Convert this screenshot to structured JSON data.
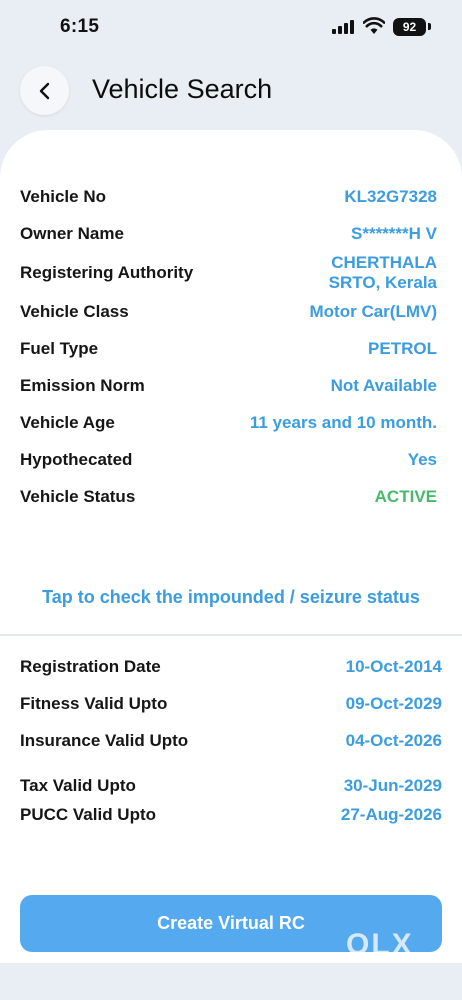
{
  "status_bar": {
    "time": "6:15",
    "battery": "92"
  },
  "header": {
    "title": "Vehicle Search"
  },
  "vehicle": [
    {
      "label": "Vehicle No",
      "value": "KL32G7328"
    },
    {
      "label": "Owner Name",
      "value": "S*******H V"
    },
    {
      "label": "Registering Authority",
      "value_line1": "CHERTHALA",
      "value_line2": "SRTO, Kerala"
    },
    {
      "label": "Vehicle Class",
      "value": "Motor Car(LMV)"
    },
    {
      "label": "Fuel Type",
      "value": "PETROL"
    },
    {
      "label": "Emission Norm",
      "value": "Not Available"
    },
    {
      "label": "Vehicle Age",
      "value": "11 years and 10 month."
    },
    {
      "label": "Hypothecated",
      "value": "Yes"
    },
    {
      "label": "Vehicle Status",
      "value": "ACTIVE"
    }
  ],
  "impound_link": "Tap to check the impounded / seizure status",
  "validity": [
    {
      "label": "Registration Date",
      "value": "10-Oct-2014"
    },
    {
      "label": "Fitness Valid Upto",
      "value": "09-Oct-2029"
    },
    {
      "label": "Insurance Valid Upto",
      "value": "04-Oct-2026"
    },
    {
      "label": "Tax Valid Upto",
      "value": "30-Jun-2029"
    },
    {
      "label": "PUCC Valid Upto",
      "value": "27-Aug-2026"
    }
  ],
  "cta": {
    "label": "Create Virtual RC"
  },
  "watermark": {
    "text": "OLX"
  },
  "colors": {
    "accent": "#3b9de0",
    "active": "#47b96b",
    "button": "#55a9ee"
  }
}
